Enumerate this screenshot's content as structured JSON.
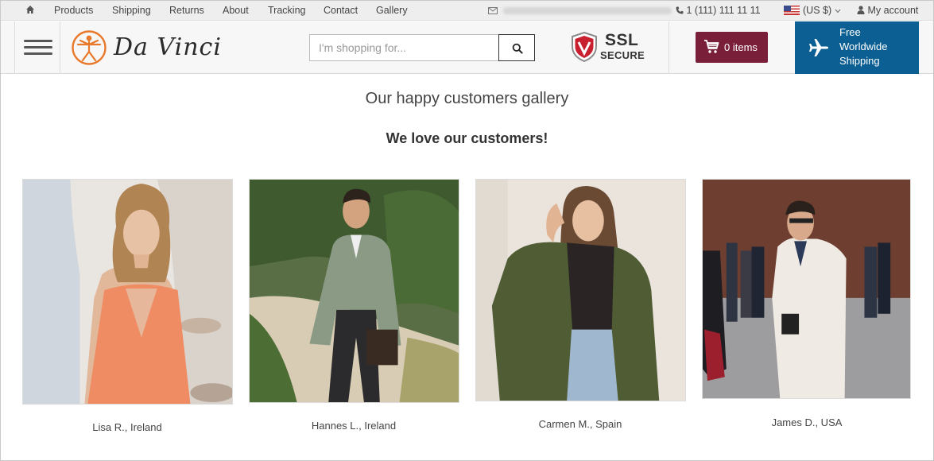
{
  "topbar": {
    "nav": [
      "Products",
      "Shipping",
      "Returns",
      "About",
      "Tracking",
      "Contact",
      "Gallery"
    ],
    "phone": "1 (111) 111 11 11",
    "currency": "(US $)",
    "account": "My account"
  },
  "header": {
    "logo_text": "Da Vinci",
    "search_placeholder": "I'm shopping for...",
    "ssl_big": "SSL",
    "ssl_small": "SECURE",
    "cart_label": "0 items",
    "shipping_label": "Free\nWorldwide\nShipping"
  },
  "gallery": {
    "title": "Our happy customers gallery",
    "subtitle": "We love our customers!",
    "customers": [
      {
        "caption": "Lisa R., Ireland"
      },
      {
        "caption": "Hannes L., Ireland"
      },
      {
        "caption": "Carmen M., Spain"
      },
      {
        "caption": "James D., USA"
      }
    ]
  },
  "colors": {
    "cart_bg": "#7a1f3a",
    "shipping_bg": "#0c5f93",
    "logo_orange": "#e8782a"
  }
}
